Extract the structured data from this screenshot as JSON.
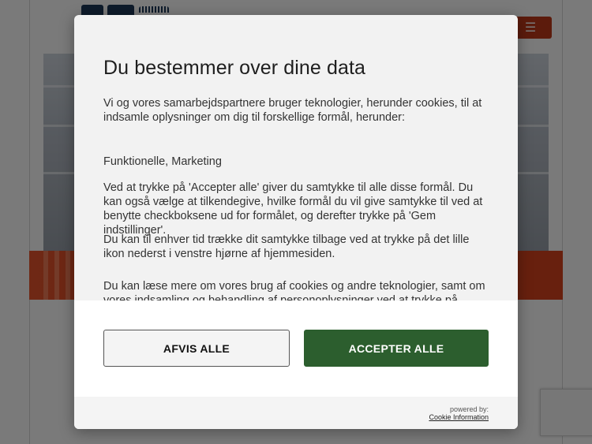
{
  "background": {
    "menu_icon": "hamburger-icon",
    "accent_color": "#c0391b",
    "bar_color": "#e8542c"
  },
  "dialog": {
    "title": "Du bestemmer over dine data",
    "intro": "Vi og vores samarbejdspartnere bruger teknologier, herunder cookies, til at indsamle oplysninger om dig til forskellige formål, herunder:",
    "purposes": "Funktionelle, Marketing",
    "accept_info": "Ved at trykke på 'Accepter alle' giver du samtykke til alle disse formål. Du kan også vælge at tilkendegive, hvilke formål du vil give samtykke til ved at benytte checkboksene ud for formålet, og derefter trykke på 'Gem indstillinger'.",
    "withdraw_info": "Du kan til enhver tid trække dit samtykke tilbage ved at trykke på det lille ikon nederst i venstre hjørne af hjemmesiden.",
    "read_more": "Du kan læse mere om vores brug af cookies og andre teknologier, samt om vores indsamling og behandling af personoplysninger ved at trykke på",
    "reject_label": "AFVIS ALLE",
    "accept_label": "ACCEPTER ALLE",
    "accept_color": "#2c5e2e",
    "powered_by": "powered by:",
    "powered_link": "Cookie Information"
  }
}
